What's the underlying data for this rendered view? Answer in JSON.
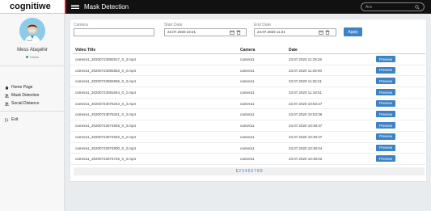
{
  "app": {
    "brand": "cognitiwe",
    "page_title": "Mask Detection"
  },
  "search": {
    "placeholder": "Ara"
  },
  "user": {
    "name": "Mess Ataşehir",
    "status": "Online"
  },
  "nav": [
    {
      "label": "Home Page",
      "icon": "home-icon"
    },
    {
      "label": "Mask Detection",
      "icon": "users-icon"
    },
    {
      "label": "Social Distance",
      "icon": "users-icon"
    }
  ],
  "exit": {
    "label": "Exit",
    "icon": "sign-out-icon"
  },
  "filters": {
    "camera_label": "Camera",
    "camera_value": "",
    "start_label": "Start Date",
    "start_value": "22.07.2020 23:21",
    "end_label": "End Date",
    "end_value": "23.07.2020 11:21",
    "apply_label": "Apply"
  },
  "table": {
    "columns": [
      "Video Title",
      "Camera",
      "Date"
    ],
    "preview_label": "Preview",
    "rows": [
      [
        "camera1_20200723082917_0_3.mp4",
        "camera1",
        "23.07.2020 11:29:26"
      ],
      [
        "camera1_20200723082853_0_0.mp4",
        "camera1",
        "23.07.2020 11:29:00"
      ],
      [
        "camera1_20200723082655_0_3.mp4",
        "camera1",
        "23.07.2020 11:26:21"
      ],
      [
        "camera1_20200723081844_0_2.mp4",
        "camera1",
        "23.07.2020 11:18:51"
      ],
      [
        "camera1_20200723075342_0_3.mp4",
        "camera1",
        "23.07.2020 10:53:47"
      ],
      [
        "camera1_20200723075321_0_3.mp4",
        "camera1",
        "23.07.2020 10:53:36"
      ],
      [
        "camera1_20200723074925_0_3.mp4",
        "camera1",
        "23.07.2020 10:49:37"
      ],
      [
        "camera1_20200723074840_0_2.mp4",
        "camera1",
        "23.07.2020 10:48:47"
      ],
      [
        "camera1_20200723074800_0_3.mp4",
        "camera1",
        "23.07.2020 10:48:04"
      ],
      [
        "camera1_20200723074746_0_3.mp4",
        "camera1",
        "23.07.2020 10:48:02"
      ]
    ]
  },
  "pagination": {
    "pages": [
      "1",
      "2",
      "3",
      "4",
      "5",
      "6",
      "7",
      "8",
      "9"
    ],
    "current": "1"
  },
  "colors": {
    "topbar": "#111111",
    "accent": "#3b82c6",
    "brand_red": "#dd1111",
    "online": "#2eaa4a"
  }
}
